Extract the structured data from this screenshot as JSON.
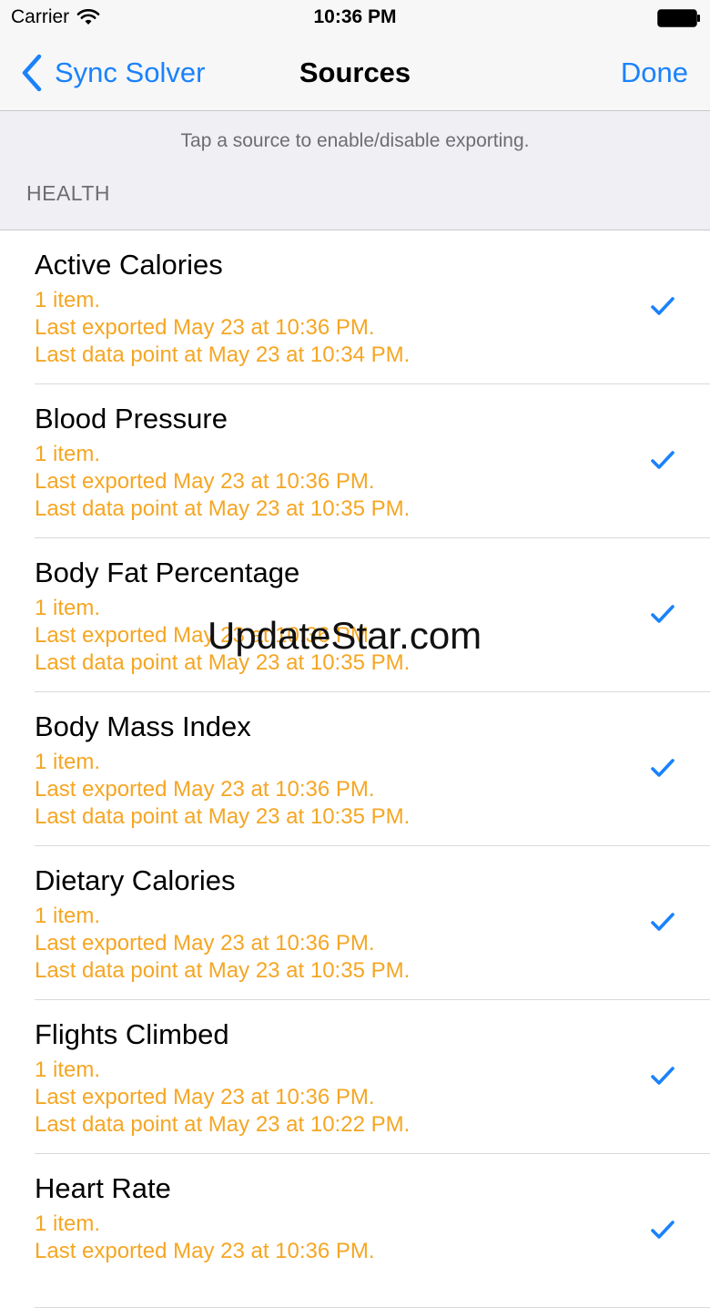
{
  "status_bar": {
    "carrier": "Carrier",
    "time": "10:36 PM"
  },
  "nav": {
    "back_label": "Sync Solver",
    "title": "Sources",
    "done_label": "Done"
  },
  "hint": "Tap a source to enable/disable exporting.",
  "section_title": "HEALTH",
  "sources": [
    {
      "name": "Active Calories",
      "items": "1 item.",
      "last_exported": "Last exported May 23 at 10:36 PM.",
      "last_data_point": "Last data point at May 23 at 10:34 PM.",
      "checked": true
    },
    {
      "name": "Blood Pressure",
      "items": "1 item.",
      "last_exported": "Last exported May 23 at 10:36 PM.",
      "last_data_point": "Last data point at May 23 at 10:35 PM.",
      "checked": true
    },
    {
      "name": "Body Fat Percentage",
      "items": "1 item.",
      "last_exported": "Last exported May 23 at 10:36 PM.",
      "last_data_point": "Last data point at May 23 at 10:35 PM.",
      "checked": true
    },
    {
      "name": "Body Mass Index",
      "items": "1 item.",
      "last_exported": "Last exported May 23 at 10:36 PM.",
      "last_data_point": "Last data point at May 23 at 10:35 PM.",
      "checked": true
    },
    {
      "name": "Dietary Calories",
      "items": "1 item.",
      "last_exported": "Last exported May 23 at 10:36 PM.",
      "last_data_point": "Last data point at May 23 at 10:35 PM.",
      "checked": true
    },
    {
      "name": "Flights Climbed",
      "items": "1 item.",
      "last_exported": "Last exported May 23 at 10:36 PM.",
      "last_data_point": "Last data point at May 23 at 10:22 PM.",
      "checked": true
    },
    {
      "name": "Heart Rate",
      "items": "1 item.",
      "last_exported": "Last exported May 23 at 10:36 PM.",
      "last_data_point": "",
      "checked": true
    }
  ],
  "watermark": "UpdateStar.com",
  "colors": {
    "accent": "#1a82fb",
    "detail": "#f5a623",
    "grouped_background": "#efeff4"
  },
  "icons": {
    "back": "chevron-left-icon",
    "check": "checkmark-icon",
    "wifi": "wifi-icon",
    "battery": "battery-icon"
  }
}
